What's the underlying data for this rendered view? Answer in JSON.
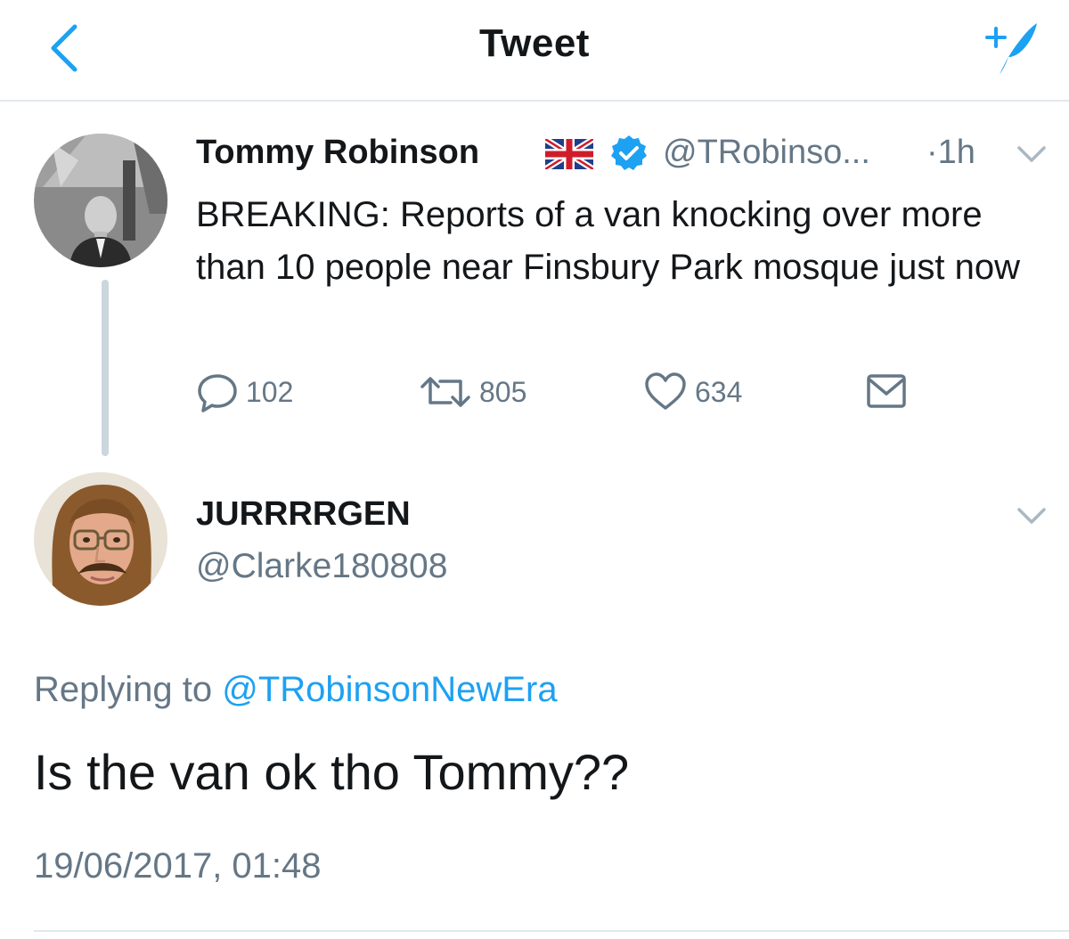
{
  "header": {
    "title": "Tweet",
    "back_icon": "chevron-left-icon",
    "compose_icon": "compose-tweet-icon",
    "accent": "#1da1f2"
  },
  "original_tweet": {
    "name": "Tommy Robinson",
    "flag": "uk-flag",
    "verified": true,
    "handle": "@TRobinso...",
    "time": "·1h",
    "text": "BREAKING: Reports of a van knocking over more than 10 people near Finsbury Park mosque just now",
    "replies": "102",
    "retweets": "805",
    "likes": "634"
  },
  "reply_tweet": {
    "name": "JURRRRGEN",
    "handle": "@Clarke180808",
    "replying_prefix": "Replying to",
    "replying_to": "@TRobinsonNewEra",
    "text": "Is the van ok tho Tommy??",
    "timestamp": "19/06/2017, 01:48"
  }
}
